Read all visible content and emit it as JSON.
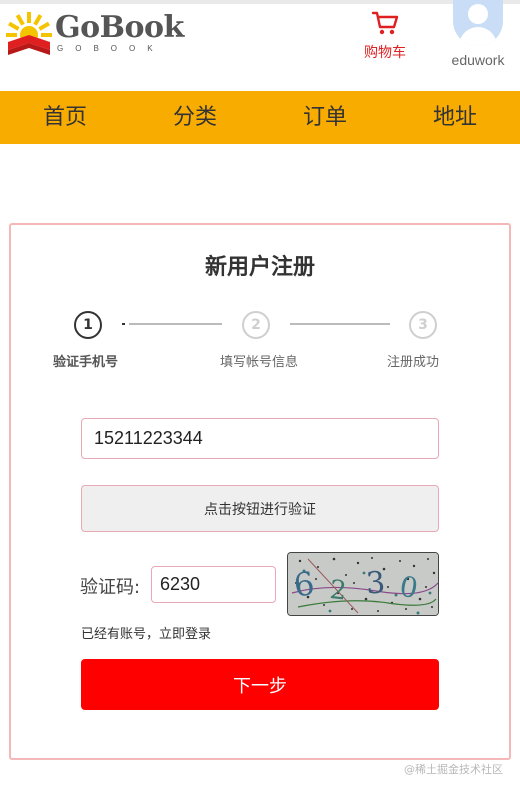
{
  "header": {
    "logo_title": "GoBook",
    "logo_subtitle": "GOBOOK",
    "cart_label": "购物车",
    "username": "eduwork"
  },
  "nav": {
    "items": [
      {
        "label": "首页"
      },
      {
        "label": "分类"
      },
      {
        "label": "订单"
      },
      {
        "label": "地址"
      }
    ]
  },
  "register": {
    "title": "新用户注册",
    "steps": [
      {
        "number": "1",
        "label": "验证手机号"
      },
      {
        "number": "2",
        "label": "填写帐号信息"
      },
      {
        "number": "3",
        "label": "注册成功"
      }
    ],
    "active_step": 1,
    "phone_value": "15211223344",
    "verify_button": "点击按钮进行验证",
    "code_label": "验证码:",
    "code_value": "6230",
    "captcha_text": "6230",
    "login_link": "已经有账号，立即登录",
    "next_button": "下一步"
  },
  "watermark": "@稀土掘金技术社区",
  "colors": {
    "nav_bg": "#f9ac00",
    "cart_red": "#e02020",
    "next_button_bg": "#fe0000",
    "card_border": "#f4b8b8"
  }
}
